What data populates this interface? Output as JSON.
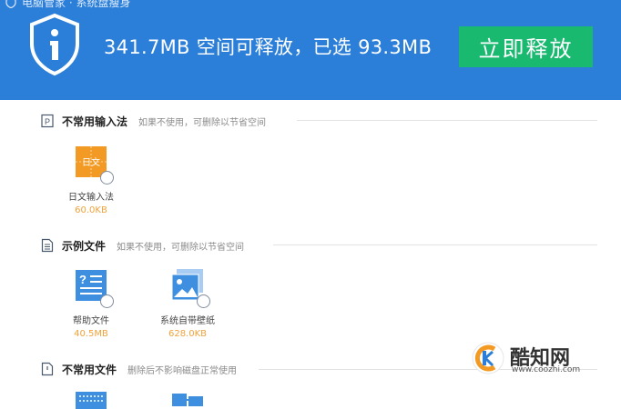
{
  "header": {
    "breadcrumb": "电脑管家 · 系统盘瘦身",
    "summary": "341.7MB 空间可释放，已选 93.3MB",
    "release_button": "立即释放"
  },
  "sections": [
    {
      "title": "不常用输入法",
      "desc": "如果不使用，可删除以节省空间",
      "items": [
        {
          "name": "日文输入法",
          "size": "60.0KB",
          "icon": "japanese-ime-icon",
          "icon_text": "日文"
        }
      ]
    },
    {
      "title": "示例文件",
      "desc": "如果不使用，可删除以节省空间",
      "items": [
        {
          "name": "帮助文件",
          "size": "40.5MB",
          "icon": "help-file-icon"
        },
        {
          "name": "系统自带壁纸",
          "size": "628.0KB",
          "icon": "wallpaper-icon"
        }
      ]
    },
    {
      "title": "不常用文件",
      "desc": "删除后不影响磁盘正常使用",
      "items": []
    }
  ],
  "watermark": {
    "logo_text": "酷知网",
    "url": "www.coozhi.com"
  },
  "colors": {
    "header_bg": "#2c7fd9",
    "button_bg": "#19b970",
    "size_text": "#f0a23b"
  }
}
